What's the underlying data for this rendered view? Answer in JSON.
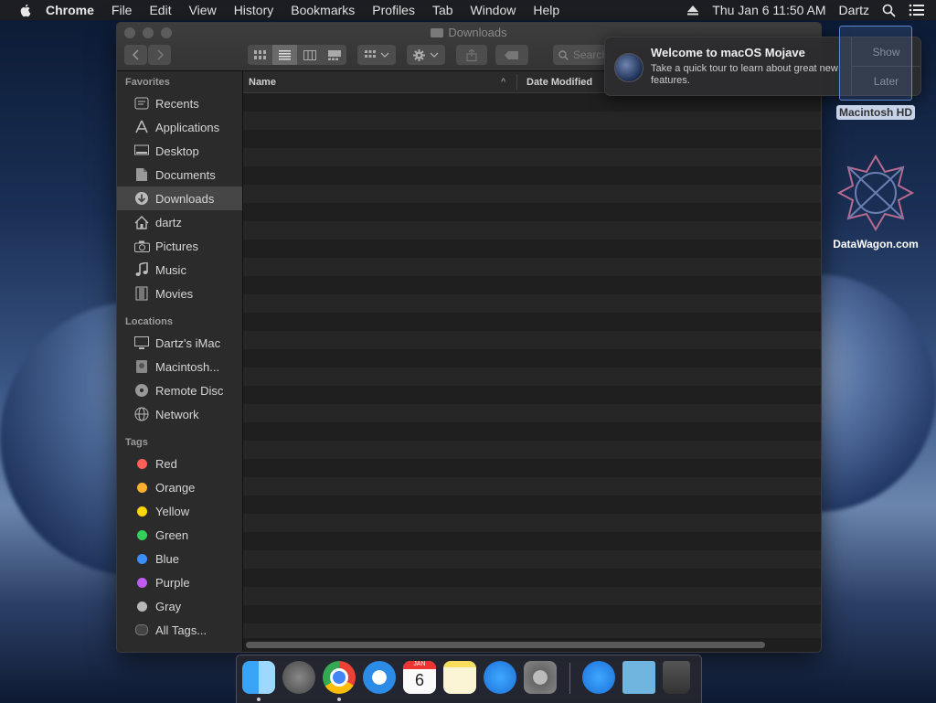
{
  "menubar": {
    "items": [
      "Chrome",
      "File",
      "Edit",
      "View",
      "History",
      "Bookmarks",
      "Profiles",
      "Tab",
      "Window",
      "Help"
    ],
    "clock": "Thu Jan 6  11:50 AM",
    "user": "Dartz"
  },
  "window": {
    "title": "Downloads",
    "search_placeholder": "Search"
  },
  "sidebar": {
    "favorites_header": "Favorites",
    "favorites": [
      "Recents",
      "Applications",
      "Desktop",
      "Documents",
      "Downloads",
      "dartz",
      "Pictures",
      "Music",
      "Movies"
    ],
    "locations_header": "Locations",
    "locations": [
      "Dartz's iMac",
      "Macintosh...",
      "Remote Disc",
      "Network"
    ],
    "tags_header": "Tags",
    "tags": [
      {
        "label": "Red",
        "color": "#ff5f57"
      },
      {
        "label": "Orange",
        "color": "#ffb02e"
      },
      {
        "label": "Yellow",
        "color": "#ffd60a"
      },
      {
        "label": "Green",
        "color": "#34d058"
      },
      {
        "label": "Blue",
        "color": "#3a8ef6"
      },
      {
        "label": "Purple",
        "color": "#bf5af2"
      },
      {
        "label": "Gray",
        "color": "#b8b8b8"
      }
    ],
    "all_tags": "All Tags..."
  },
  "list": {
    "col_name": "Name",
    "col_date": "Date Modified"
  },
  "notification": {
    "title": "Welcome to macOS Mojave",
    "body": "Take a quick tour to learn about great new features.",
    "show": "Show",
    "later": "Later"
  },
  "desktop": {
    "hd_label": "Macintosh HD",
    "datawagon_label": "DataWagon.com"
  },
  "dock": {
    "apps": [
      "finder-icon",
      "launchpad-icon",
      "chrome-icon",
      "safari-icon",
      "calendar-icon",
      "notes-icon",
      "app-store-icon",
      "system-preferences-icon",
      "app-store-download-icon",
      "downloads-folder-icon",
      "trash-icon"
    ],
    "calendar_month": "JAN",
    "calendar_day": "6"
  }
}
